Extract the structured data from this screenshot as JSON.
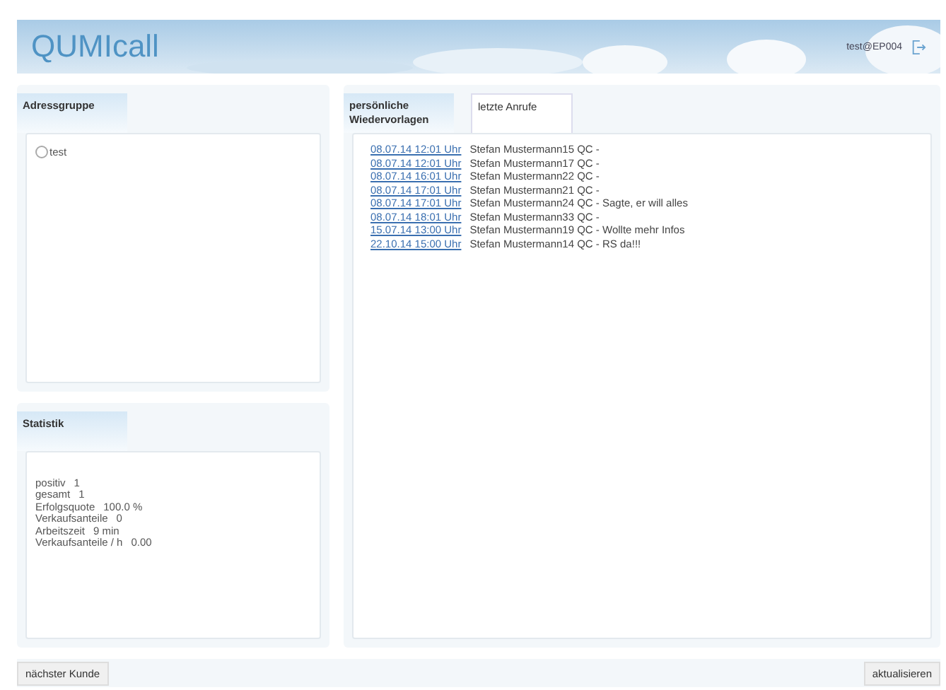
{
  "header": {
    "logo": "QUMIcall",
    "user": "test@EP004"
  },
  "address_group": {
    "title": "Adressgruppe",
    "items": [
      {
        "label": "test",
        "checked": false
      }
    ]
  },
  "statistics": {
    "title": "Statistik",
    "rows": [
      {
        "label": "positiv",
        "value": "1"
      },
      {
        "label": "gesamt",
        "value": "1"
      },
      {
        "label": "Erfolgsquote",
        "value": "100.0 %"
      },
      {
        "label": "Verkaufsanteile",
        "value": "0"
      },
      {
        "label": "Arbeitszeit",
        "value": "9 min"
      },
      {
        "label": "Verkaufsanteile / h",
        "value": "0.00"
      }
    ]
  },
  "tabs": [
    {
      "label": "persönliche Wiedervorlagen",
      "selected": true
    },
    {
      "label": "letzte Anrufe",
      "selected": false
    }
  ],
  "entries": [
    {
      "date": "08.07.14 12:01 Uhr",
      "text": "Stefan Mustermann15 QC -"
    },
    {
      "date": "08.07.14 12:01 Uhr",
      "text": "Stefan Mustermann17 QC -"
    },
    {
      "date": "08.07.14 16:01 Uhr",
      "text": "Stefan Mustermann22 QC -"
    },
    {
      "date": "08.07.14 17:01 Uhr",
      "text": "Stefan Mustermann21 QC -"
    },
    {
      "date": "08.07.14 17:01 Uhr",
      "text": "Stefan Mustermann24 QC - Sagte, er will alles"
    },
    {
      "date": "08.07.14 18:01 Uhr",
      "text": "Stefan Mustermann33 QC -"
    },
    {
      "date": "15.07.14 13:00 Uhr",
      "text": "Stefan Mustermann19 QC - Wollte mehr Infos"
    },
    {
      "date": "22.10.14 15:00 Uhr",
      "text": "Stefan Mustermann14 QC - RS da!!!"
    }
  ],
  "buttons": {
    "left": "nächster Kunde",
    "right": "aktualisieren"
  }
}
